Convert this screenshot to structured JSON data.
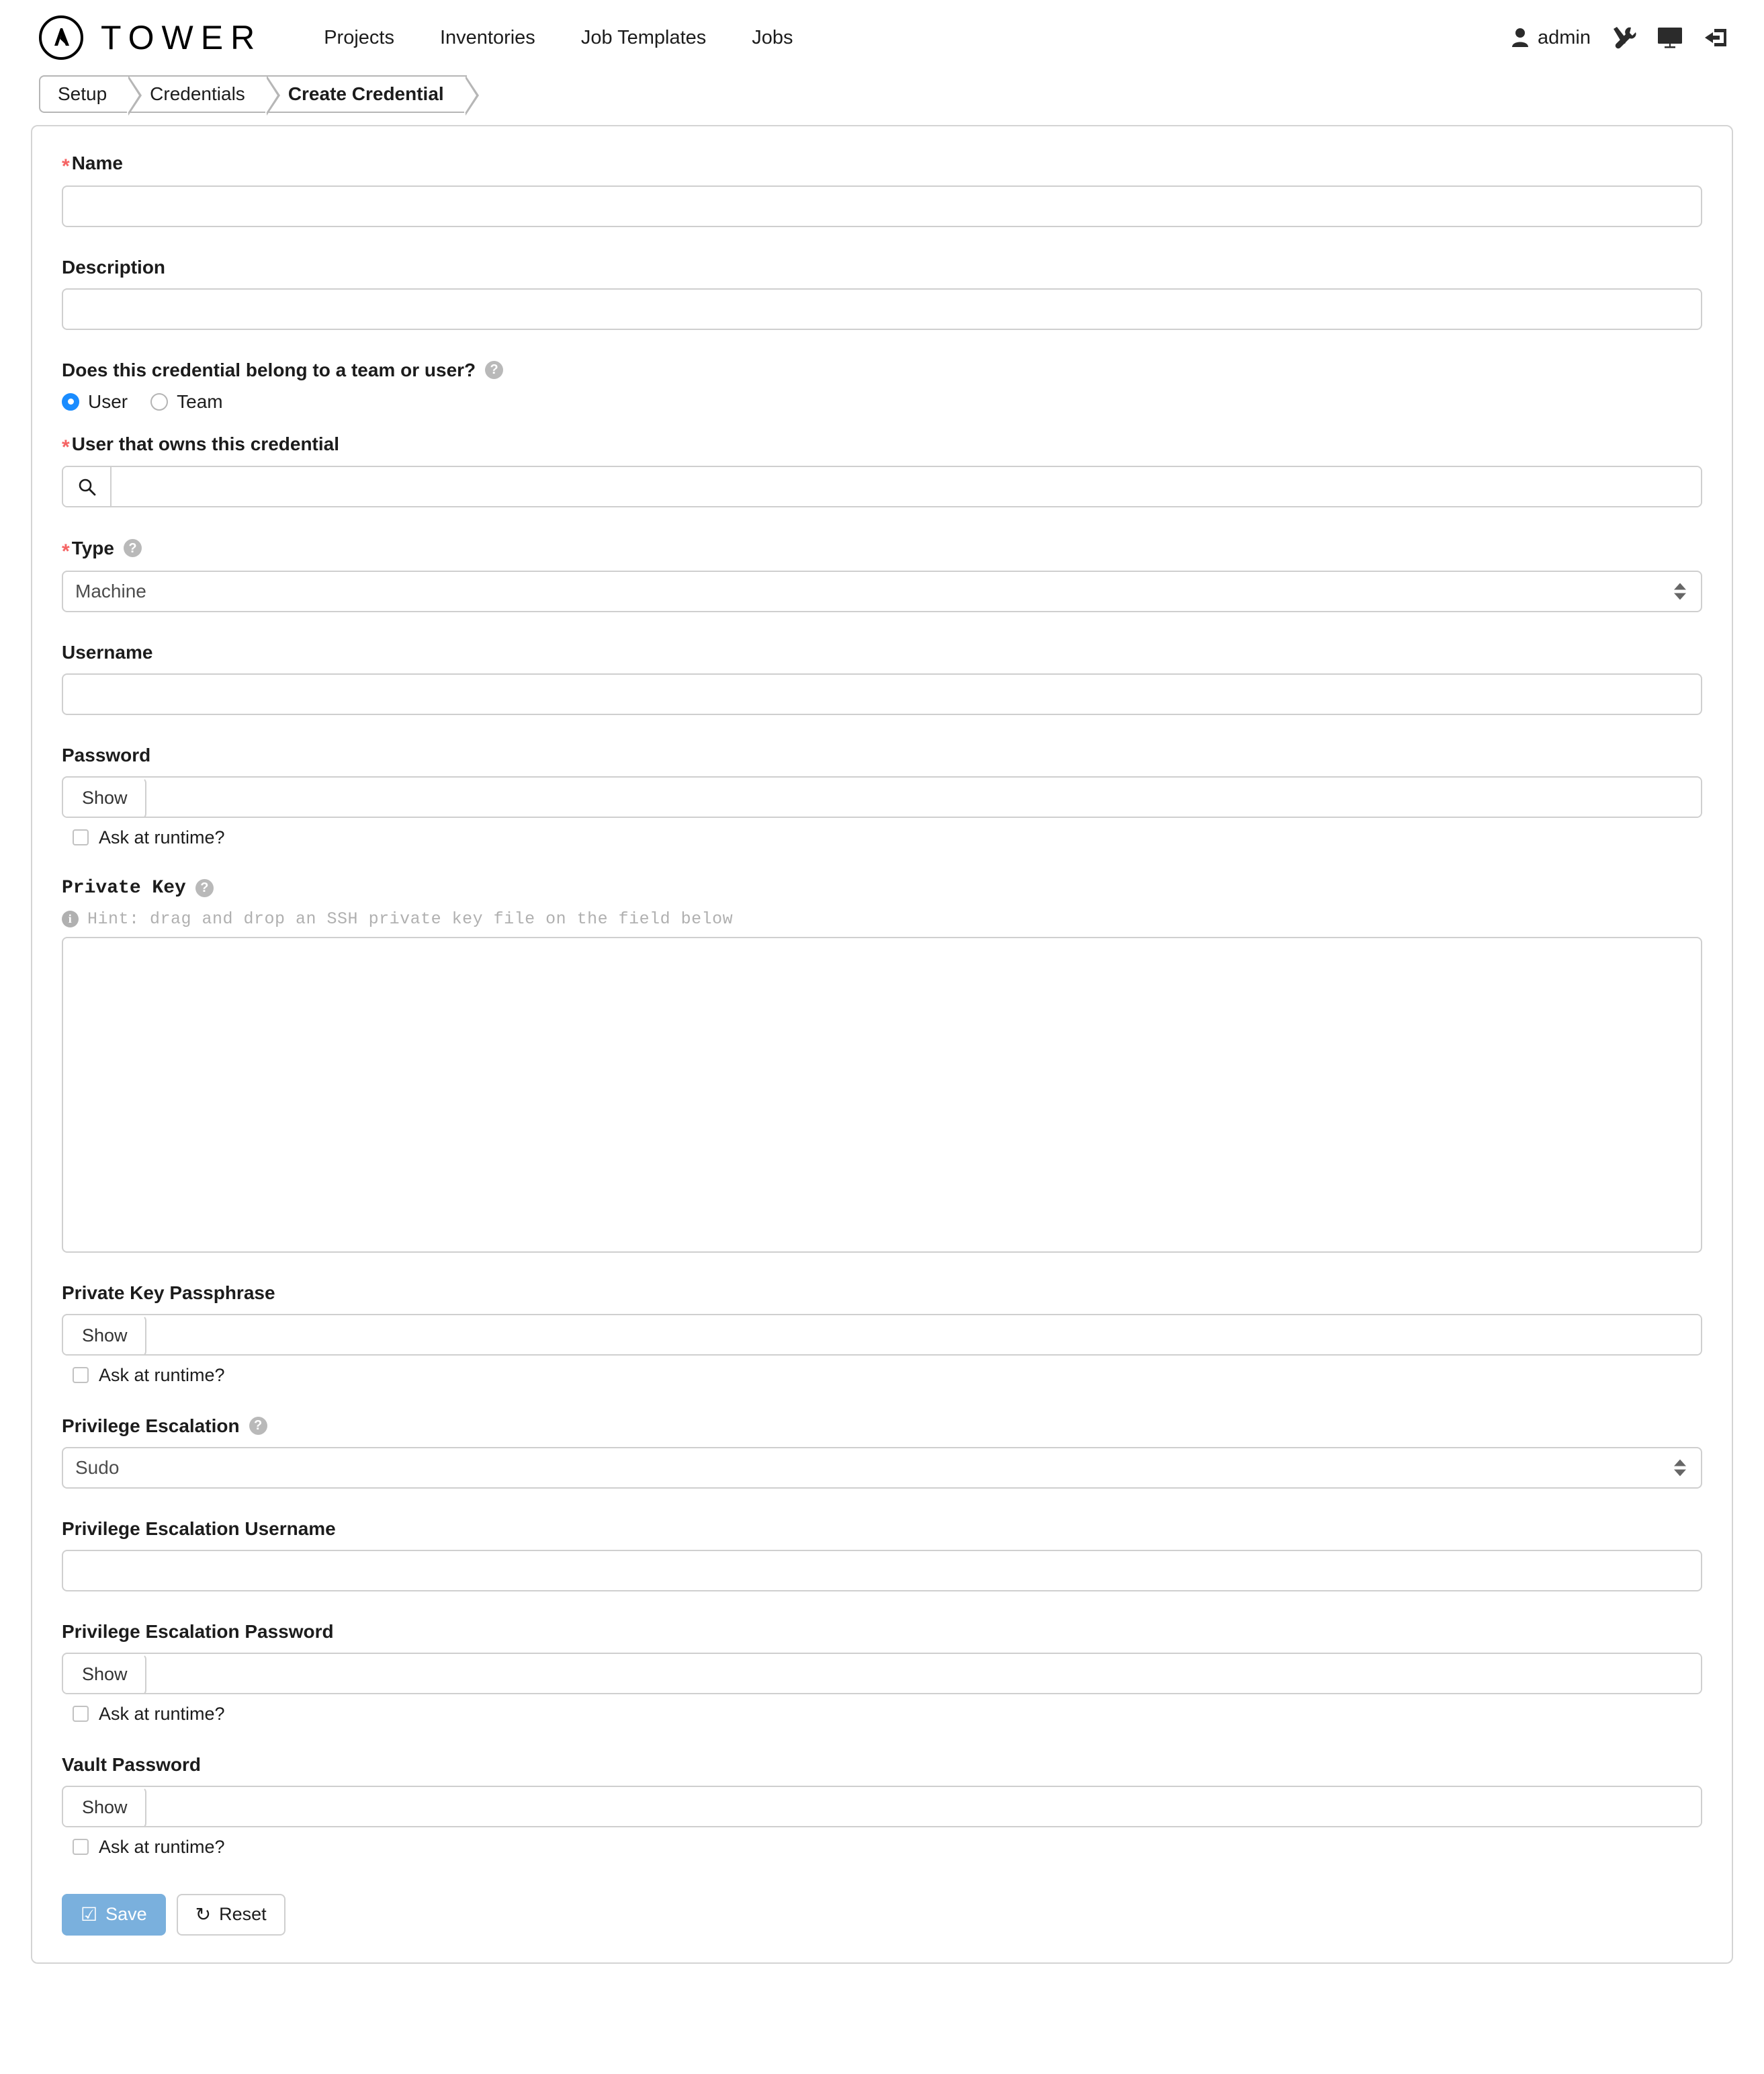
{
  "header": {
    "brand": "TOWER",
    "logo_icon": "ansible-a-logo-icon",
    "nav": [
      {
        "label": "Projects"
      },
      {
        "label": "Inventories"
      },
      {
        "label": "Job Templates"
      },
      {
        "label": "Jobs"
      }
    ],
    "user": "admin",
    "icons": {
      "user": "user-icon",
      "tools": "wrench-screwdriver-icon",
      "monitor": "monitor-icon",
      "logout": "logout-icon"
    }
  },
  "breadcrumb": [
    {
      "label": "Setup",
      "active": false
    },
    {
      "label": "Credentials",
      "active": false
    },
    {
      "label": "Create Credential",
      "active": true
    }
  ],
  "form": {
    "name": {
      "label": "Name",
      "required": true,
      "value": "",
      "placeholder": ""
    },
    "description": {
      "label": "Description",
      "required": false,
      "value": "",
      "placeholder": ""
    },
    "ownership": {
      "label": "Does this credential belong to a team or user?",
      "help_icon": "question-circle-icon",
      "options": [
        {
          "label": "User",
          "selected": true
        },
        {
          "label": "Team",
          "selected": false
        }
      ]
    },
    "owner": {
      "label": "User that owns this credential",
      "required": true,
      "value": "",
      "placeholder": "",
      "search_icon": "search-icon"
    },
    "type": {
      "label": "Type",
      "required": true,
      "help_icon": "question-circle-icon",
      "value": "Machine",
      "options": [
        "Machine"
      ]
    },
    "username": {
      "label": "Username",
      "value": "",
      "placeholder": ""
    },
    "password": {
      "label": "Password",
      "show_label": "Show",
      "value": "",
      "ask_label": "Ask at runtime?",
      "ask_checked": false
    },
    "private_key": {
      "label": "Private Key",
      "help_icon": "question-circle-icon",
      "hint_icon": "info-circle-icon",
      "hint": "Hint: drag and drop an SSH private key file on the field below",
      "value": "",
      "placeholder": ""
    },
    "private_key_passphrase": {
      "label": "Private Key Passphrase",
      "show_label": "Show",
      "value": "",
      "ask_label": "Ask at runtime?",
      "ask_checked": false
    },
    "privilege_escalation": {
      "label": "Privilege Escalation",
      "help_icon": "question-circle-icon",
      "value": "Sudo",
      "options": [
        "Sudo"
      ]
    },
    "privilege_escalation_username": {
      "label": "Privilege Escalation Username",
      "value": "",
      "placeholder": ""
    },
    "privilege_escalation_password": {
      "label": "Privilege Escalation Password",
      "show_label": "Show",
      "value": "",
      "ask_label": "Ask at runtime?",
      "ask_checked": false
    },
    "vault_password": {
      "label": "Vault Password",
      "show_label": "Show",
      "value": "",
      "ask_label": "Ask at runtime?",
      "ask_checked": false
    }
  },
  "actions": {
    "save": {
      "label": "Save",
      "icon": "check-square-icon"
    },
    "reset": {
      "label": "Reset",
      "icon": "undo-icon"
    }
  },
  "colors": {
    "required_asterisk": "#f56363",
    "radio_selected": "#1a8cff",
    "save_button": "#7ab0dd",
    "border": "#cfcfcf",
    "help_icon": "#b9b9b9"
  }
}
